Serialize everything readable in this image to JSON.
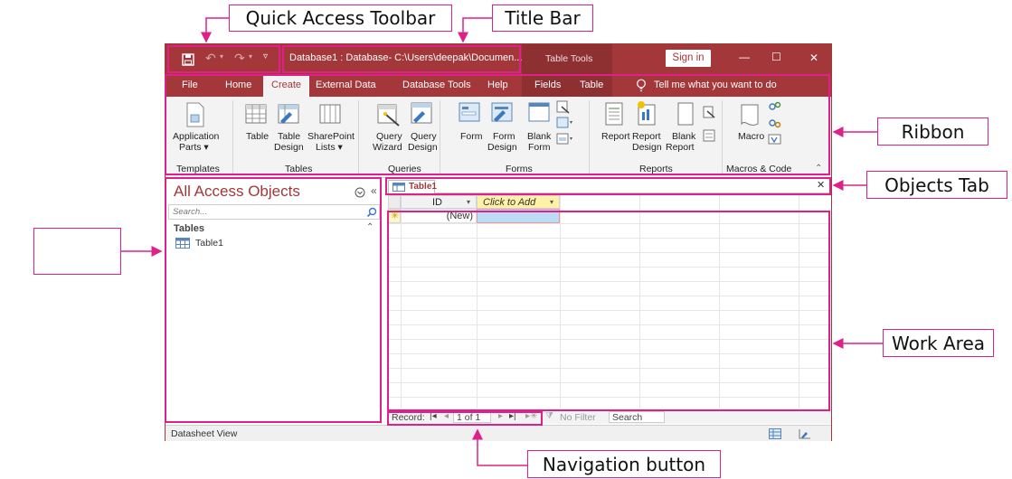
{
  "callouts": {
    "quick_access_toolbar": "Quick Access Toolbar",
    "title_bar": "Title Bar",
    "ribbon": "Ribbon",
    "objects_tab": "Objects Tab",
    "work_area": "Work Area",
    "navigation_button": "Navigation button",
    "nav_pane_blank": ""
  },
  "titlebar": {
    "title": "Database1 : Database- C:\\Users\\deepak\\Documen...",
    "context": "Table Tools",
    "sign_in": "Sign in",
    "minimize": "—",
    "maximize": "☐",
    "close": "✕"
  },
  "tabs": {
    "file": "File",
    "home": "Home",
    "create": "Create",
    "external": "External Data",
    "dbtools": "Database Tools",
    "help": "Help",
    "fields": "Fields",
    "table": "Table",
    "tell": "Tell me what you want to do"
  },
  "ribbon": {
    "app_parts_1": "Application",
    "app_parts_2": "Parts ▾",
    "table": "Table",
    "table_design_1": "Table",
    "table_design_2": "Design",
    "sharepoint_1": "SharePoint",
    "sharepoint_2": "Lists ▾",
    "query_wizard_1": "Query",
    "query_wizard_2": "Wizard",
    "query_design_1": "Query",
    "query_design_2": "Design",
    "form": "Form",
    "form_design_1": "Form",
    "form_design_2": "Design",
    "blank_form_1": "Blank",
    "blank_form_2": "Form",
    "report": "Report",
    "report_design_1": "Report",
    "report_design_2": "Design",
    "blank_report_1": "Blank",
    "blank_report_2": "Report",
    "macro": "Macro",
    "groups": {
      "templates": "Templates",
      "tables": "Tables",
      "queries": "Queries",
      "forms": "Forms",
      "reports": "Reports",
      "macros": "Macros & Code"
    }
  },
  "navpane": {
    "title": "All Access Objects",
    "search_placeholder": "Search...",
    "section": "Tables",
    "items": [
      "Table1"
    ]
  },
  "objecttab": {
    "label": "Table1"
  },
  "datasheet": {
    "col_id": "ID",
    "col_add": "Click to Add",
    "new_row": "(New)"
  },
  "recordnav": {
    "record_label": "Record:",
    "position": "1 of 1",
    "filter": "No Filter",
    "search": "Search"
  },
  "status": {
    "view": "Datasheet View"
  },
  "colors": {
    "accent": "#a4373a",
    "callout": "#e0208a",
    "add_header": "#fff2a8"
  }
}
